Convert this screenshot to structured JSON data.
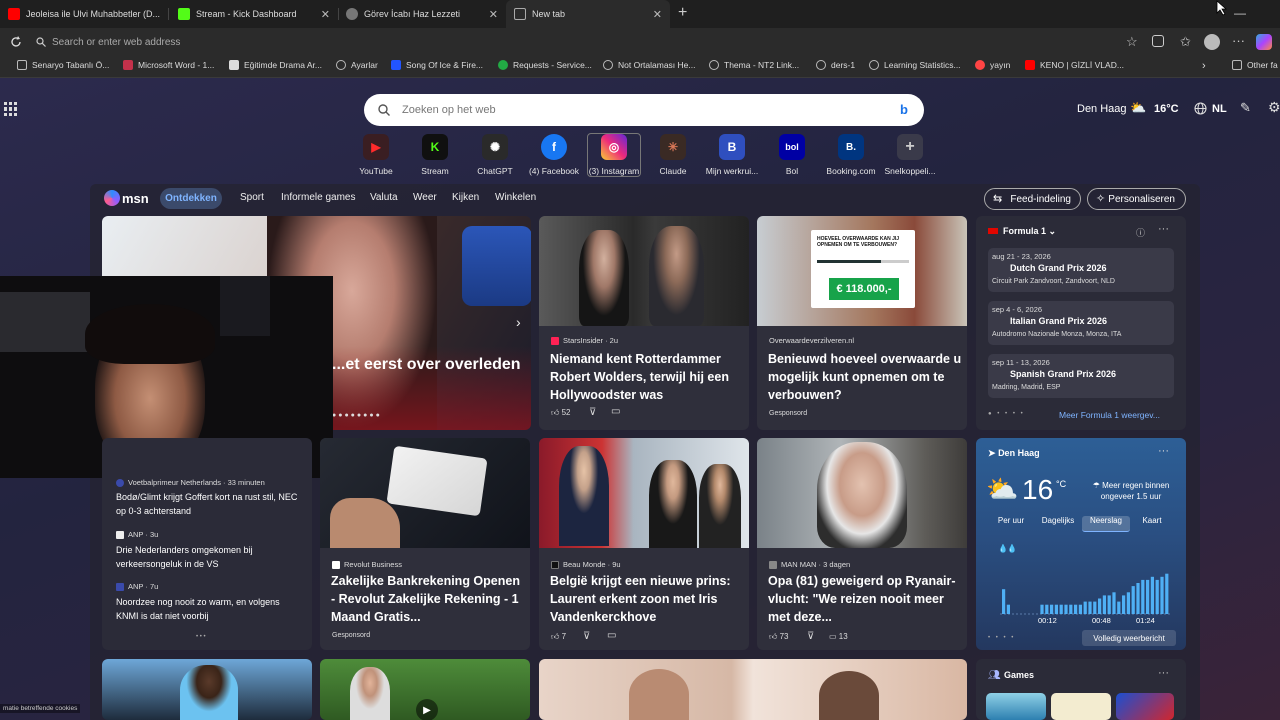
{
  "tabs": [
    {
      "label": "Jeoleisa ile Ulvi Muhabbetler (D...",
      "favicon_color": "#ff0000"
    },
    {
      "label": "Stream - Kick Dashboard",
      "favicon_color": "#53fc18"
    },
    {
      "label": "Görev İcabı Haz Lezzeti",
      "favicon_color": "#888888"
    },
    {
      "label": "New tab",
      "favicon_color": "#aaaaaa"
    }
  ],
  "address": {
    "placeholder": "Search or enter web address"
  },
  "favorites": [
    {
      "label": "Senaryo Tabanlı Ö...",
      "color": "#bbbbbb"
    },
    {
      "label": "Microsoft Word - 1...",
      "color": "#c4314b"
    },
    {
      "label": "Eğitimde Drama Ar...",
      "color": "#dddddd"
    },
    {
      "label": "Ayarlar",
      "color": "#bbbbbb"
    },
    {
      "label": "Song Of Ice & Fire...",
      "color": "#2255ff"
    },
    {
      "label": "Requests - Service...",
      "color": "#22aa44"
    },
    {
      "label": "Not Ortalaması He...",
      "color": "#bbbbbb"
    },
    {
      "label": "Thema - NT2 Link...",
      "color": "#bbbbbb"
    },
    {
      "label": "ders-1",
      "color": "#bbbbbb"
    },
    {
      "label": "Learning Statistics...",
      "color": "#bbbbbb"
    },
    {
      "label": "yayın",
      "color": "#ff4444"
    },
    {
      "label": "KENO | GİZLİ VLAD...",
      "color": "#ff0000"
    },
    {
      "label": "Other fa",
      "color": "#bbbbbb"
    }
  ],
  "search": {
    "placeholder": "Zoeken op het web"
  },
  "top_right": {
    "city": "Den Haag",
    "temp": "16°C",
    "lang": "NL"
  },
  "quicklinks": [
    {
      "label": "YouTube",
      "glyph": "▶",
      "bg": "#3a1e22",
      "fg": "#ff2b2b"
    },
    {
      "label": "Stream",
      "glyph": "K",
      "bg": "#101010",
      "fg": "#53fc18"
    },
    {
      "label": "ChatGPT",
      "glyph": "✺",
      "bg": "#2a2a2a",
      "fg": "#ffffff"
    },
    {
      "label": "(4) Facebook",
      "glyph": "f",
      "bg": "#1877f2",
      "fg": "#ffffff"
    },
    {
      "label": "(3) Instagram",
      "glyph": "◎",
      "bg": "#d62976",
      "fg": "#ffffff"
    },
    {
      "label": "Claude",
      "glyph": "✳",
      "bg": "#3a2a24",
      "fg": "#d97757"
    },
    {
      "label": "Mijn werkrui...",
      "glyph": "B",
      "bg": "#2f4fbf",
      "fg": "#ffffff"
    },
    {
      "label": "Bol",
      "glyph": "bol",
      "bg": "#0000a4",
      "fg": "#ffffff"
    },
    {
      "label": "Booking.com",
      "glyph": "B.",
      "bg": "#003580",
      "fg": "#ffffff"
    },
    {
      "label": "Snelkoppeli...",
      "glyph": "+",
      "bg": "#3a3a4a",
      "fg": "#cccccc"
    }
  ],
  "msn": {
    "logo": "msn",
    "nav": [
      "Ontdekken",
      "Sport",
      "Informele games",
      "Valuta",
      "Weer",
      "Kijken",
      "Winkelen"
    ],
    "feed_layout": "Feed-indeling",
    "personalize": "Personaliseren"
  },
  "hero": {
    "title": "...et eerst over overleden"
  },
  "cards": [
    {
      "source": "StarsInsider · 2u",
      "title": "Niemand kent Rotterdammer Robert Wolders, terwijl hij een Hollywoodster was",
      "likes": "52"
    },
    {
      "source": "Overwaardeverzilveren.nl",
      "title": "Benieuwd hoeveel overwaarde u mogelijk kunt opnemen om te verbouwen?",
      "sponsored": "Gesponsord",
      "ad_head": "HOEVEEL OVERWAARDE KAN JIJ OPNEMEN OM TE VERBOUWEN?",
      "ad_price": "€ 118.000,-"
    },
    {
      "source": "Revolut Business",
      "title": "Zakelijke Bankrekening Openen - Revolut Zakelijke Rekening - 1 Maand Gratis...",
      "sponsored": "Gesponsord"
    },
    {
      "source": "Beau Monde · 9u",
      "title": "België krijgt een nieuwe prins: Laurent erkent zoon met Iris Vandenkerckhove",
      "likes": "7"
    },
    {
      "source": "MAN MAN · 3 dagen",
      "title": "Opa (81) geweigerd op Ryanair-vlucht: \"We reizen nooit meer met deze...",
      "likes": "73",
      "comments": "13"
    }
  ],
  "news_list": [
    {
      "source": "Voetbalprimeur Netherlands · 33 minuten",
      "title": "Bodø/Glimt krijgt Goffert kort na rust stil, NEC op 0-3 achterstand"
    },
    {
      "source": "ANP · 3u",
      "title": "Drie Nederlanders omgekomen bij verkeersongeluk in de VS"
    },
    {
      "source": "ANP · 7u",
      "title": "Noordzee nog nooit zo warm, en volgens KNMI is dat niet voorbij"
    }
  ],
  "formula1": {
    "title": "Formula 1",
    "more": "Meer Formula 1 weergev...",
    "races": [
      {
        "date": "aug 21 - 23, 2026",
        "name": "Dutch Grand Prix 2026",
        "venue": "Circuit Park Zandvoort, Zandvoort, NLD"
      },
      {
        "date": "sep 4 - 6, 2026",
        "name": "Italian Grand Prix 2026",
        "venue": "Autodromo Nazionale Monza, Monza, ITA"
      },
      {
        "date": "sep 11 - 13, 2026",
        "name": "Spanish Grand Prix 2026",
        "venue": "Madring, Madrid, ESP"
      }
    ]
  },
  "weather": {
    "city": "Den Haag",
    "temp": "16",
    "unit": "°C",
    "note": "Meer regen binnen ongeveer 1.5 uur",
    "tabs": [
      "Per uur",
      "Dagelijks",
      "Neerslag",
      "Kaart"
    ],
    "times": [
      "00:12",
      "00:48",
      "01:24"
    ],
    "full": "Volledig weerbericht",
    "precip": [
      0.4,
      0.15,
      0,
      0,
      0,
      0,
      0,
      0,
      0.15,
      0.15,
      0.15,
      0.15,
      0.15,
      0.15,
      0.15,
      0.15,
      0.15,
      0.2,
      0.2,
      0.2,
      0.25,
      0.3,
      0.3,
      0.35,
      0.2,
      0.3,
      0.35,
      0.45,
      0.5,
      0.55,
      0.55,
      0.6,
      0.55,
      0.6,
      0.65
    ]
  },
  "games": {
    "title": "Games"
  },
  "cookie": "matie betreffende cookies"
}
